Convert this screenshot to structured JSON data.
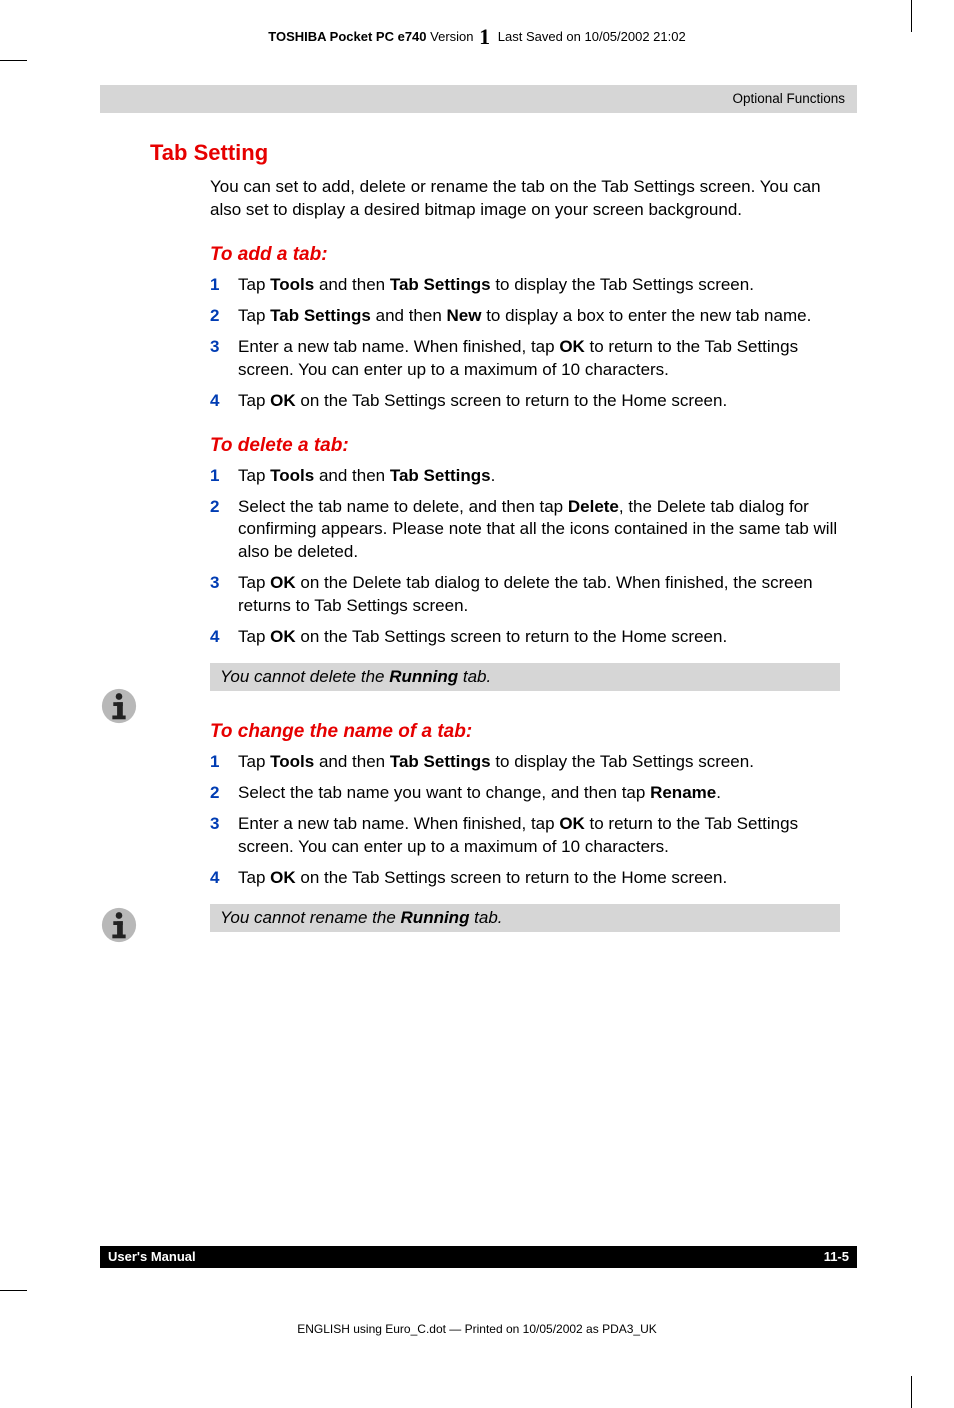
{
  "header": {
    "product": "TOSHIBA Pocket PC e740",
    "version_label": "Version",
    "version_big": "1",
    "saved": "Last Saved on 10/05/2002 21:02"
  },
  "section_label": "Optional Functions",
  "h1": "Tab Setting",
  "intro": "You can set to add, delete or rename the tab on the Tab Settings screen. You can also set to display a desired bitmap image on your screen background.",
  "add": {
    "heading": "To add a tab:",
    "s1a": "Tap ",
    "s1b": "Tools",
    "s1c": " and then ",
    "s1d": "Tab Settings",
    "s1e": " to display the Tab Settings screen.",
    "s2a": "Tap ",
    "s2b": "Tab Settings",
    "s2c": " and then ",
    "s2d": "New",
    "s2e": " to display a box to enter the new tab name.",
    "s3a": "Enter a new tab name. When finished, tap ",
    "s3b": "OK",
    "s3c": " to return to the Tab Settings screen. You can enter up to a maximum of 10 characters.",
    "s4a": "Tap ",
    "s4b": "OK",
    "s4c": " on the Tab Settings screen to return to the Home screen."
  },
  "del": {
    "heading": "To delete a tab:",
    "s1a": "Tap ",
    "s1b": "Tools",
    "s1c": " and then ",
    "s1d": "Tab Settings",
    "s1e": ".",
    "s2a": "Select the tab name to delete, and then tap ",
    "s2b": "Delete",
    "s2c": ", the Delete tab dialog for confirming appears. Please note that all the icons contained in the same tab will also be deleted.",
    "s3a": "Tap ",
    "s3b": "OK",
    "s3c": " on the Delete tab dialog to delete the tab. When finished, the screen returns to Tab Settings screen.",
    "s4a": "Tap ",
    "s4b": "OK",
    "s4c": " on the Tab Settings screen to return to the Home screen.",
    "note_a": "You cannot delete the ",
    "note_b": "Running",
    "note_c": " tab."
  },
  "ren": {
    "heading": "To change the name of a tab:",
    "s1a": "Tap ",
    "s1b": "Tools",
    "s1c": " and then ",
    "s1d": "Tab Settings",
    "s1e": " to display the Tab Settings screen.",
    "s2a": "Select the tab name you want to change, and then tap ",
    "s2b": "Rename",
    "s2c": ".",
    "s3a": "Enter a new tab name. When finished, tap ",
    "s3b": "OK",
    "s3c": " to return to the Tab Settings screen. You can enter up to a maximum of 10 characters.",
    "s4a": "Tap ",
    "s4b": "OK",
    "s4c": " on the Tab Settings screen to return to the Home screen.",
    "note_a": "You cannot rename the ",
    "note_b": "Running",
    "note_c": " tab."
  },
  "nums": {
    "n1": "1",
    "n2": "2",
    "n3": "3",
    "n4": "4"
  },
  "footer": {
    "left": "User's Manual",
    "right": "11-5"
  },
  "bottom": "ENGLISH using  Euro_C.dot — Printed on 10/05/2002 as PDA3_UK"
}
